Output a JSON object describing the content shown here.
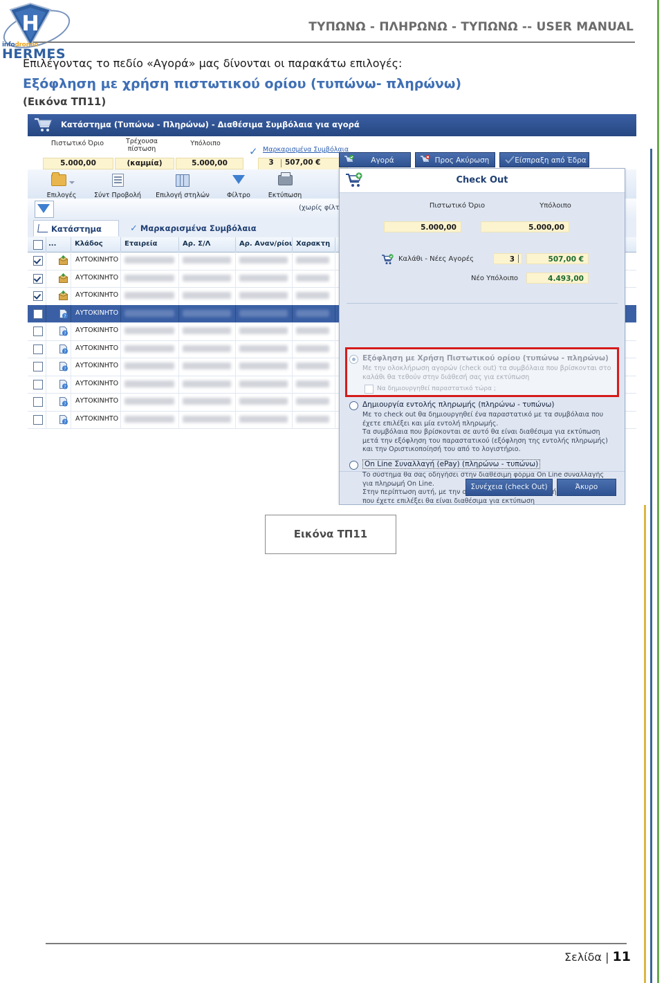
{
  "document": {
    "header_title": "ΤΥΠΩΝΩ - ΠΛΗΡΩΝΩ - ΤΥΠΩΝΩ -- USER MANUAL",
    "logo": {
      "brand_small_1": "info",
      "brand_small_2": "dromio",
      "brand_main": "HERMES",
      "letter": "H"
    },
    "intro_line": "Επιλέγοντας το πεδίο «Αγορά» μας δίνονται οι παρακάτω επιλογές:",
    "heading": "Εξόφληση με χρήση πιστωτικού ορίου (τυπώνω- πληρώνω)",
    "figure_ref": "(Εικόνα ΤΠ11)",
    "figure_caption": "Εικόνα ΤΠ11",
    "footer_label": "Σελίδα |",
    "footer_page_number": "11"
  },
  "screenshot": {
    "app": {
      "title": "Κατάστημα (Τυπώνω - Πληρώνω) - Διαθέσιμα Συμβόλαια για αγορά",
      "credit_summary": {
        "labels": [
          "Πιστωτικό Όριο",
          "Τρέχουσα πίστωση",
          "Υπόλοιπο"
        ],
        "values": [
          "5.000,00",
          "(καμμία)",
          "5.000,00"
        ],
        "marked_link": "Μαρκαρισμένα Συμβόλαια",
        "marked_count": "3",
        "marked_amount": "507,00 €"
      },
      "ribbon": [
        {
          "label": "Επιλογές",
          "icon": "folder-icon"
        },
        {
          "label": "Σύντ Προβολή",
          "icon": "sheet-icon"
        },
        {
          "label": "Επιλογή στηλών",
          "icon": "columns-icon"
        },
        {
          "label": "Φίλτρο",
          "icon": "funnel-icon"
        },
        {
          "label": "Εκτύπωση",
          "icon": "printer-icon"
        }
      ],
      "filter_bar": {
        "status": "(χωρίς φίλτρο)"
      },
      "tabs": [
        {
          "label": "Κατάστημα",
          "active": true
        },
        {
          "label": "Μαρκαρισμένα Συμβόλαια",
          "active": false
        }
      ],
      "grid": {
        "columns": [
          "",
          "...",
          "",
          "Κλάδος",
          "Εταιρεία",
          "Αρ. Σ/Λ",
          "Αρ. Αναν/ρίου",
          "Χαρακτη"
        ],
        "rows": [
          {
            "checked": true,
            "selected": false,
            "klados": "ΑΥΤΟΚΙΝΗΤΟ",
            "icon": "package-green-icon"
          },
          {
            "checked": true,
            "selected": false,
            "klados": "ΑΥΤΟΚΙΝΗΤΟ",
            "icon": "package-green-icon"
          },
          {
            "checked": true,
            "selected": false,
            "klados": "ΑΥΤΟΚΙΝΗΤΟ",
            "icon": "package-green-icon"
          },
          {
            "checked": false,
            "selected": true,
            "klados": "ΑΥΤΟΚΙΝΗΤΟ",
            "icon": "doc-question-icon"
          },
          {
            "checked": false,
            "selected": false,
            "klados": "ΑΥΤΟΚΙΝΗΤΟ",
            "icon": "doc-question-icon"
          },
          {
            "checked": false,
            "selected": false,
            "klados": "ΑΥΤΟΚΙΝΗΤΟ",
            "icon": "doc-question-icon"
          },
          {
            "checked": false,
            "selected": false,
            "klados": "ΑΥΤΟΚΙΝΗΤΟ",
            "icon": "doc-question-icon"
          },
          {
            "checked": false,
            "selected": false,
            "klados": "ΑΥΤΟΚΙΝΗΤΟ",
            "icon": "doc-question-icon"
          },
          {
            "checked": false,
            "selected": false,
            "klados": "ΑΥΤΟΚΙΝΗΤΟ",
            "icon": "doc-question-icon"
          },
          {
            "checked": false,
            "selected": false,
            "klados": "ΑΥΤΟΚΙΝΗΤΟ",
            "icon": "doc-question-icon"
          }
        ]
      }
    },
    "overlay": {
      "action_buttons": [
        {
          "label": "Αγορά",
          "icon": "cart-check-icon"
        },
        {
          "label": "Προς Ακύρωση",
          "icon": "cart-cancel-icon"
        },
        {
          "label": "Είσπραξη από Έδρα",
          "icon": "check-icon"
        }
      ],
      "dialog": {
        "title": "Check Out",
        "credit_limit_label": "Πιστωτικό Όριο",
        "credit_limit_value": "5.000,00",
        "balance_label": "Υπόλοιπο",
        "balance_value": "5.000,00",
        "basket_label": "Καλάθι - Νέες Αγορές",
        "basket_count": "3",
        "basket_amount": "507,00 €",
        "new_balance_label": "Νέο Υπόλοιπο",
        "new_balance_value": "4.493,00",
        "options": [
          {
            "selected": true,
            "title": "Εξόφληση με Χρήση Πιστωτικού ορίου  (τυπώνω - πληρώνω)",
            "description": "Με την ολοκλήρωση αγορών (check out) τα συμβόλαια που βρίσκονται στο καλάθι θα τεθούν στην διάθεσή σας για εκτύπωση",
            "checkbox_label": "Να δημιουργηθεί παραστατικό τώρα ;",
            "checkbox_checked": false
          },
          {
            "selected": false,
            "title": "Δημιουργία εντολής πληρωμής (πληρώνω - τυπώνω)",
            "description": "Με το check out θα δημιουργηθεί ένα παραστατικό με τα συμβόλαια που έχετε επιλέξει και μία εντολή πληρωμής.\nΤα συμβόλαια που βρίσκονται σε αυτό θα είναι διαθέσιμα για εκτύπωση μετά την εξόφληση του παραστατικού (εξόφληση της εντολής πληρωμής) και την Οριστικοποίησή του από το λογιστήριο."
          },
          {
            "selected": false,
            "title": "On Line Συναλλαγή (ePay) (πληρώνω - τυπώνω)",
            "description": "Το σύστημα θα σας οδηγήσει στην διαθέσιμη φόρμα On Line συναλλαγής για πληρωμή On Line.\nΣτην περίπτωση αυτή, με την ολοκλήρωση της συναλλαγής, τα συμβόλαια που έχετε επιλέξει θα είναι διαθέσιμα για εκτύπωση"
          }
        ],
        "confirm_button": "Συνέχεια (check Out)",
        "cancel_button": "Άκυρο"
      }
    }
  },
  "colors": {
    "brand_blue": "#2f5fa0",
    "heading_blue": "#3f6fb5",
    "titlebar_blue": "#2b4d8e",
    "highlight_red": "#d51b1b",
    "edge_green": "#6aa84f",
    "edge_blue": "#3a6595",
    "edge_gold": "#ddb640",
    "value_yellow": "#fcf3cf"
  }
}
